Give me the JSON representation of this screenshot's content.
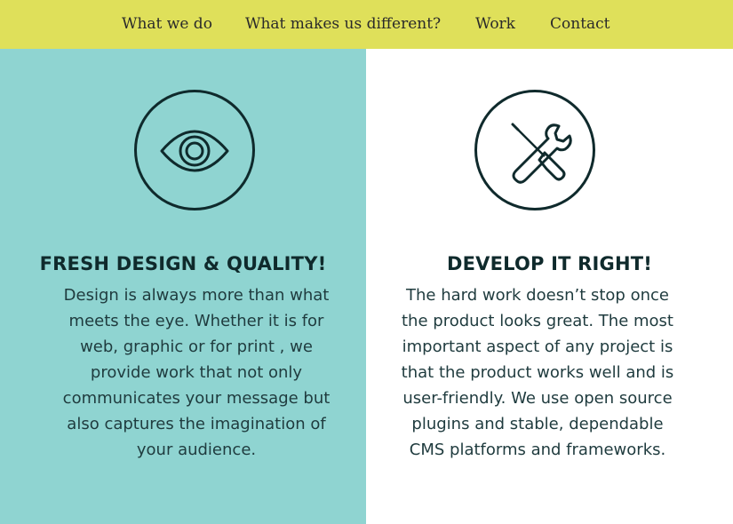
{
  "nav": {
    "items": [
      {
        "label": "What we do"
      },
      {
        "label": "What makes us different?"
      },
      {
        "label": "Work"
      },
      {
        "label": "Contact"
      }
    ]
  },
  "sections": [
    {
      "heading": "FRESH DESIGN & QUALITY!",
      "icon": "eye-icon",
      "background": "#8fd4d1",
      "body": "Design is always more than what meets the eye. Whether it is for web, graphic or  for print , we provide work that not only communicates your message but also captures the imagination of your audience."
    },
    {
      "heading": "DEVELOP IT RIGHT!",
      "icon": "tools-icon",
      "background": "#ffffff",
      "body": "The hard work doesn’t stop once the product looks great. The most important aspect of any project is that the product works well and is user-friendly.  We use open source plugins and stable, dependable CMS platforms and frameworks."
    }
  ],
  "colors": {
    "nav_background": "#dfe05a",
    "accent_teal": "#8fd4d1",
    "dark_ink": "#0f2a2c"
  }
}
